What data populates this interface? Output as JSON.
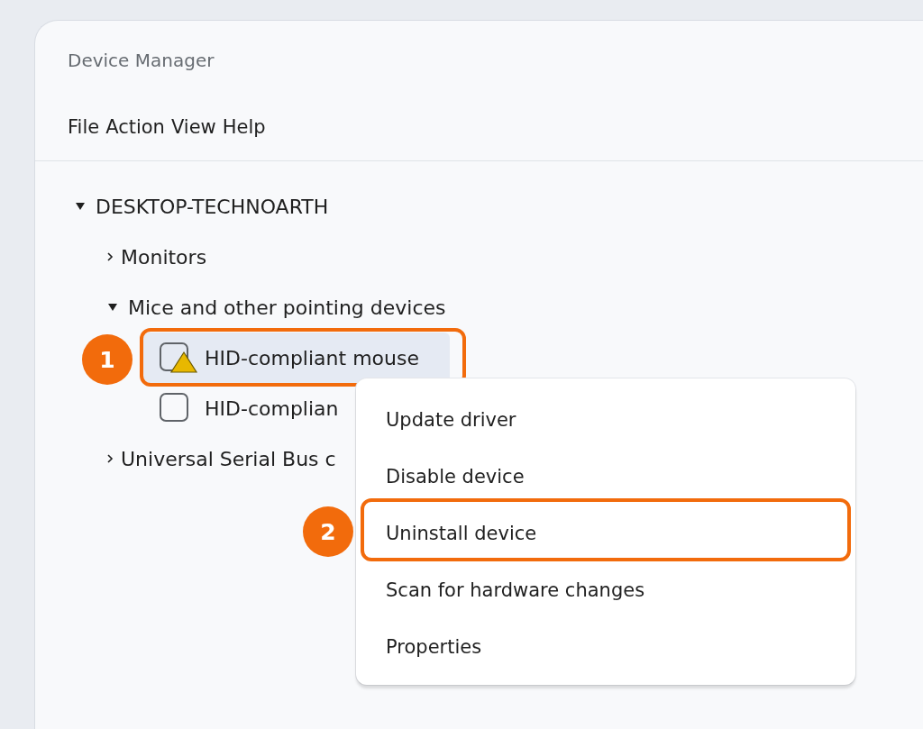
{
  "window": {
    "title": "Device Manager"
  },
  "menu_bar": [
    "File",
    "Action",
    "View",
    "Help"
  ],
  "tree": {
    "label": "DESKTOP-TECHNOARTH",
    "expanded": true,
    "children": [
      {
        "label": "Monitors",
        "expanded": false
      },
      {
        "label": "Mice and other pointing devices",
        "expanded": true,
        "children": [
          {
            "label": "HID-compliant mouse",
            "warning": true,
            "selected": true,
            "callout": "1"
          },
          {
            "label": "HID-complian",
            "warning": false,
            "selected": false
          }
        ]
      },
      {
        "label": "Universal Serial Bus c",
        "expanded": false
      }
    ]
  },
  "context_menu": [
    {
      "label": "Update driver"
    },
    {
      "label": "Disable device"
    },
    {
      "label": "Uninstall device",
      "callout": "2"
    },
    {
      "label": "Scan for hardware changes"
    },
    {
      "label": "Properties"
    }
  ]
}
